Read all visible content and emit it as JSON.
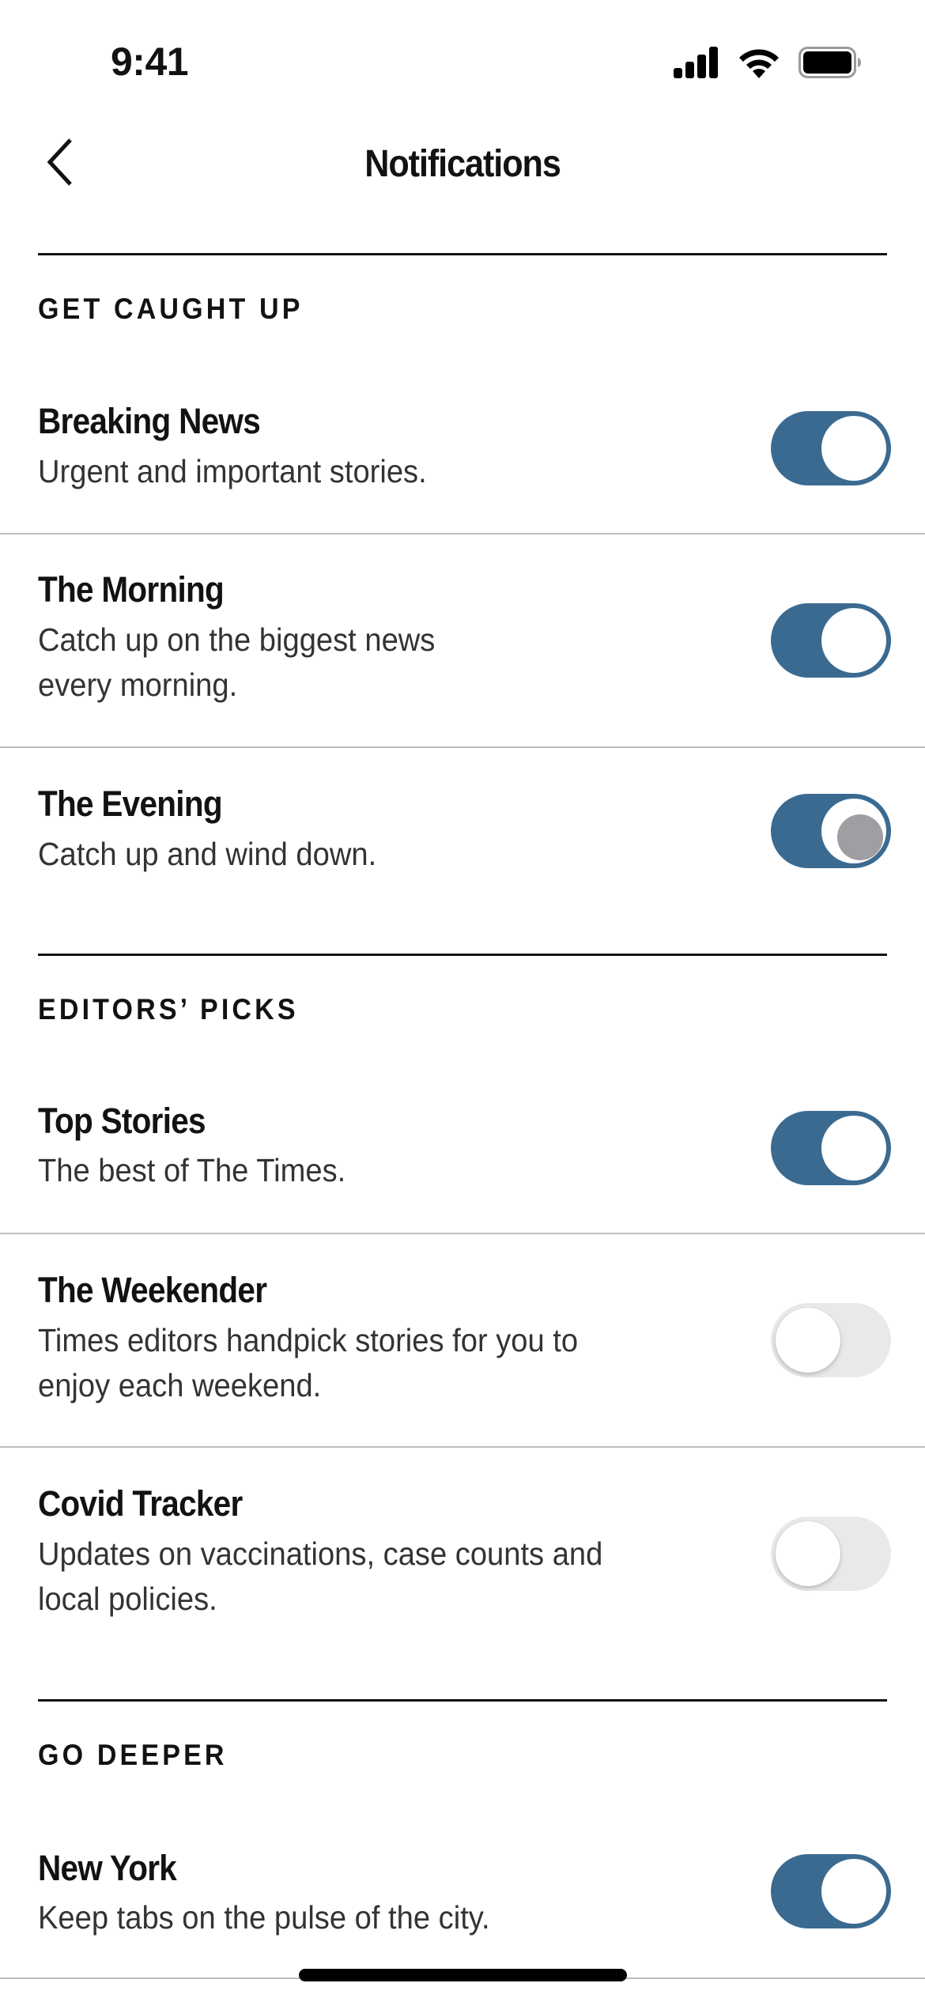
{
  "status_bar": {
    "time": "9:41",
    "icons": [
      "cellular-signal-icon",
      "wifi-icon",
      "battery-icon"
    ]
  },
  "nav": {
    "back_icon": "chevron-left-icon",
    "title": "Notifications"
  },
  "colors": {
    "toggle_on": "#3b6a91",
    "toggle_off": "#e9e9eb",
    "text_primary": "#121212",
    "text_secondary": "#333333"
  },
  "sections": [
    {
      "header": "GET CAUGHT UP",
      "items": [
        {
          "title": "Breaking News",
          "description": [
            "Urgent and important stories."
          ],
          "enabled": true
        },
        {
          "title": "The Morning",
          "description": [
            "Catch up on the biggest news",
            "every morning."
          ],
          "enabled": true
        },
        {
          "title": "The Evening",
          "description": [
            "Catch up and wind down."
          ],
          "enabled": true,
          "pressed": true
        }
      ]
    },
    {
      "header": "EDITORS’ PICKS",
      "items": [
        {
          "title": "Top Stories",
          "description": [
            "The best of The Times."
          ],
          "enabled": true
        },
        {
          "title": "The Weekender",
          "description": [
            "Times editors handpick stories for you to",
            "enjoy each weekend."
          ],
          "enabled": false
        },
        {
          "title": "Covid Tracker",
          "description": [
            "Updates on vaccinations, case counts and",
            "local policies."
          ],
          "enabled": false
        }
      ]
    },
    {
      "header": "GO DEEPER",
      "items": [
        {
          "title": "New York",
          "description": [
            "Keep tabs on the pulse of the city."
          ],
          "enabled": true
        }
      ]
    }
  ]
}
